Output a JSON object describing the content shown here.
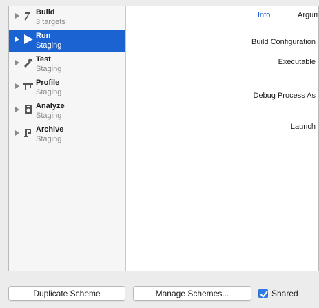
{
  "sidebar": {
    "items": [
      {
        "title": "Build",
        "subtitle": "3 targets",
        "icon": "hammer-icon"
      },
      {
        "title": "Run",
        "subtitle": "Staging",
        "icon": "play-icon",
        "selected": true
      },
      {
        "title": "Test",
        "subtitle": "Staging",
        "icon": "wrench-icon"
      },
      {
        "title": "Profile",
        "subtitle": "Staging",
        "icon": "caliper-icon"
      },
      {
        "title": "Analyze",
        "subtitle": "Staging",
        "icon": "analyze-icon"
      },
      {
        "title": "Archive",
        "subtitle": "Staging",
        "icon": "archive-icon"
      }
    ]
  },
  "main": {
    "tabs": [
      {
        "label": "Info",
        "active": true
      },
      {
        "label": "Argum"
      }
    ],
    "fields": [
      {
        "label": "Build Configuration"
      },
      {
        "label": "Executable"
      },
      {
        "label": "Debug Process As"
      },
      {
        "label": "Launch"
      }
    ]
  },
  "footer": {
    "duplicate_label": "Duplicate Scheme",
    "manage_label": "Manage Schemes...",
    "shared_label": "Shared",
    "shared_checked": true
  },
  "colors": {
    "selection": "#1b62d3",
    "active_tab": "#1b62d3",
    "checkbox": "#2e7bea"
  }
}
